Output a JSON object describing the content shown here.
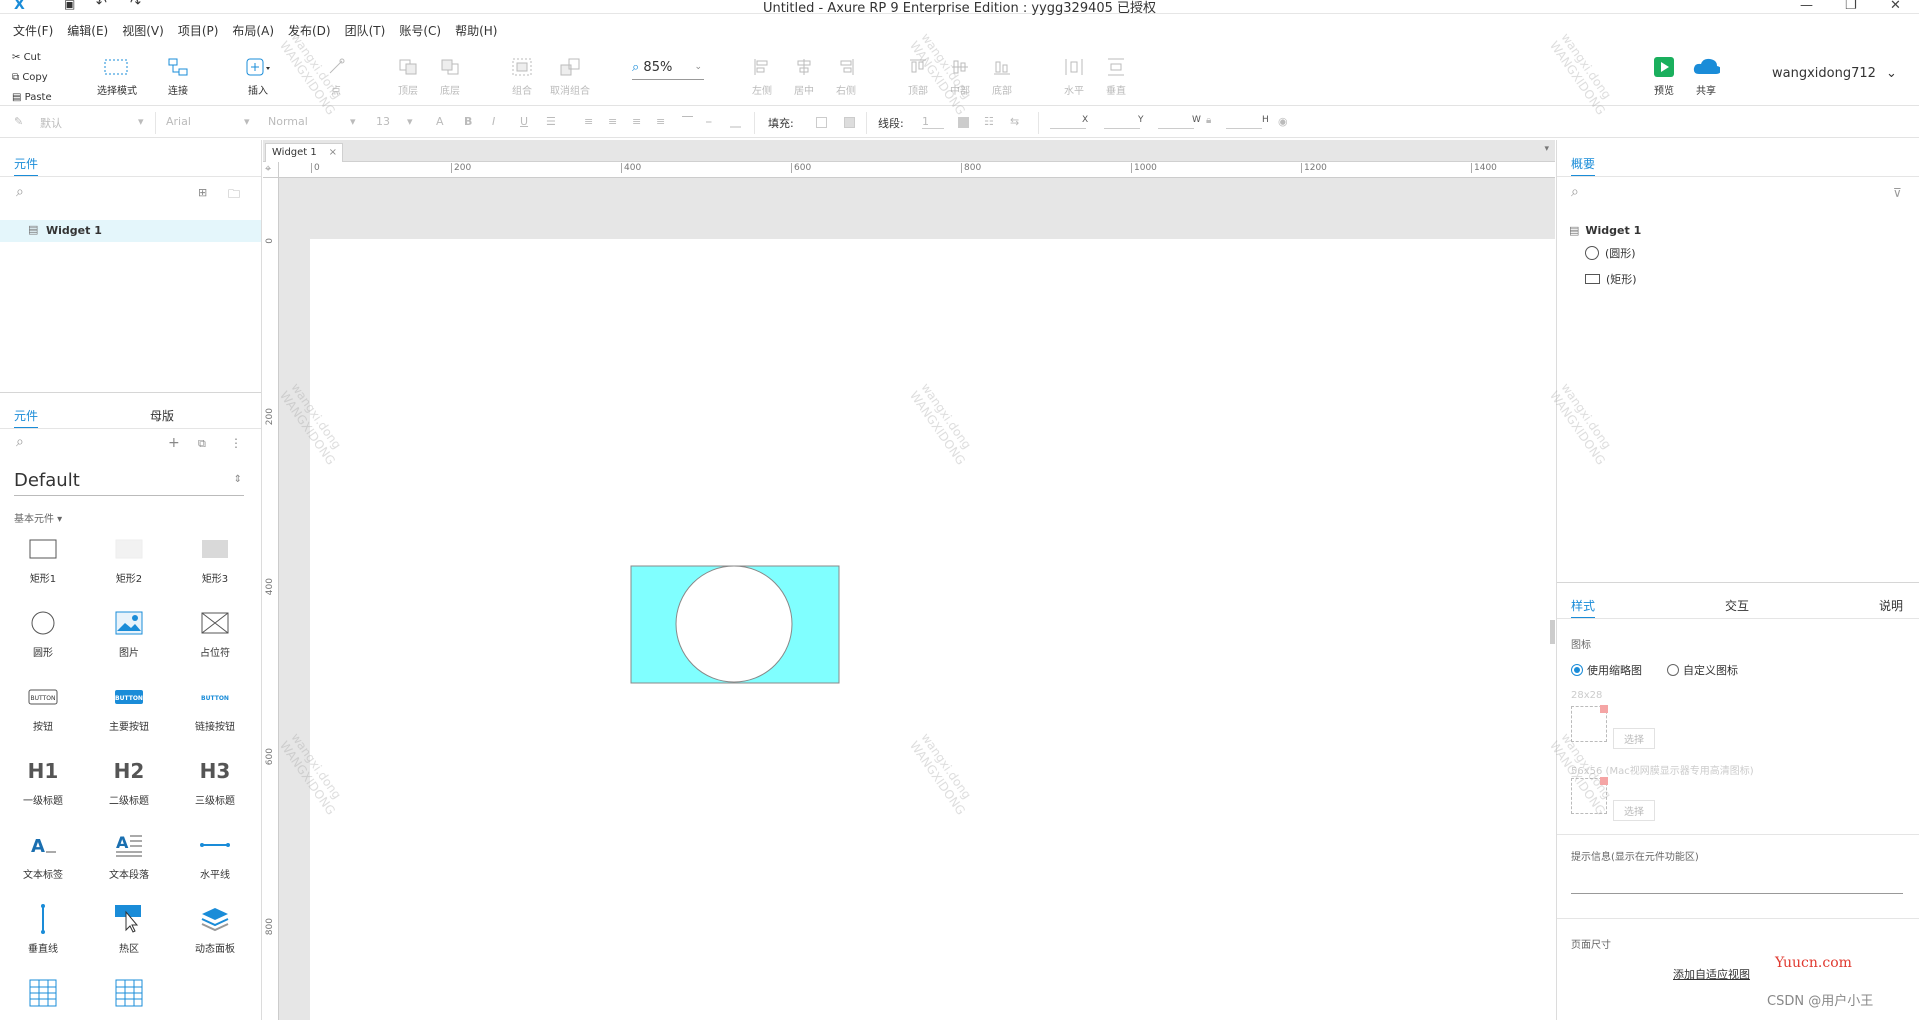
{
  "window": {
    "title": "Untitled - Axure RP 9 Enterprise Edition : yygg329405 已授权",
    "controls": [
      "—",
      "❐",
      "✕"
    ]
  },
  "menu": [
    "文件(F)",
    "编辑(E)",
    "视图(V)",
    "项目(P)",
    "布局(A)",
    "发布(D)",
    "团队(T)",
    "账号(C)",
    "帮助(H)"
  ],
  "toolbar": {
    "cut": "Cut",
    "copy": "Copy",
    "paste": "Paste",
    "select_mode": "选择模式",
    "connect": "连接",
    "insert": "插入",
    "point": "点",
    "top_layer": "顶层",
    "bottom_layer": "底层",
    "group": "组合",
    "ungroup": "取消组合",
    "zoom": "85%",
    "align_left": "左侧",
    "align_center": "居中",
    "align_right": "右侧",
    "align_top": "顶部",
    "align_middle": "中部",
    "align_bottom": "底部",
    "distribute_h": "水平",
    "distribute_v": "垂直",
    "preview": "预览",
    "share": "共享",
    "user": "wangxidong712"
  },
  "format": {
    "style": "默认",
    "font": "Arial",
    "weight": "Normal",
    "size": "13",
    "fill_label": "填充:",
    "stroke_label": "线段:",
    "stroke_value": "1",
    "x_label": "X",
    "y_label": "Y",
    "w_label": "W",
    "h_label": "H"
  },
  "pages_panel": {
    "tab": "元件",
    "pages": [
      "Widget 1"
    ]
  },
  "library_panel": {
    "tabs": [
      "元件",
      "母版"
    ],
    "library": "Default",
    "section": "基本元件",
    "items": [
      {
        "label": "矩形1",
        "icon": "rect-outline"
      },
      {
        "label": "矩形2",
        "icon": "rect-light"
      },
      {
        "label": "矩形3",
        "icon": "rect-gray"
      },
      {
        "label": "圆形",
        "icon": "circle"
      },
      {
        "label": "图片",
        "icon": "image"
      },
      {
        "label": "占位符",
        "icon": "placeholder"
      },
      {
        "label": "按钮",
        "icon": "button"
      },
      {
        "label": "主要按钮",
        "icon": "primary-button"
      },
      {
        "label": "链接按钮",
        "icon": "link-button"
      },
      {
        "label": "一级标题",
        "icon": "h1"
      },
      {
        "label": "二级标题",
        "icon": "h2"
      },
      {
        "label": "三级标题",
        "icon": "h3"
      },
      {
        "label": "文本标签",
        "icon": "text-label"
      },
      {
        "label": "文本段落",
        "icon": "text-paragraph"
      },
      {
        "label": "水平线",
        "icon": "hline"
      },
      {
        "label": "垂直线",
        "icon": "vline"
      },
      {
        "label": "热区",
        "icon": "hotspot"
      },
      {
        "label": "动态面板",
        "icon": "dynamic-panel"
      }
    ]
  },
  "canvas": {
    "tab": "Widget 1",
    "ruler_h": [
      "0",
      "200",
      "400",
      "600",
      "800",
      "1000",
      "1200",
      "1400"
    ],
    "ruler_v": [
      "0",
      "200",
      "400",
      "600",
      "800"
    ],
    "rect_color": "#80ffff",
    "circle_color": "#ffffff"
  },
  "outline_panel": {
    "tab": "概要",
    "root": "Widget 1",
    "items": [
      "(圆形)",
      "(矩形)"
    ]
  },
  "style_panel": {
    "tabs": [
      "样式",
      "交互",
      "说明"
    ],
    "icon_label": "图标",
    "radio_thumbnail": "使用缩略图",
    "radio_custom": "自定义图标",
    "size_28": "28x28",
    "choose": "选择",
    "size_56": "56x56  (Mac视网膜显示器专用高清图标)",
    "tooltip_label": "提示信息(显示在元件功能区)",
    "page_size_label": "页面尺寸",
    "adaptive_link": "添加自适应视图"
  },
  "watermark_text": "wangxi.dong",
  "watermark_text2": "WANGXIDONG",
  "footer_brand": "Yuucn.com",
  "footer_csdn": "CSDN @用户小王"
}
